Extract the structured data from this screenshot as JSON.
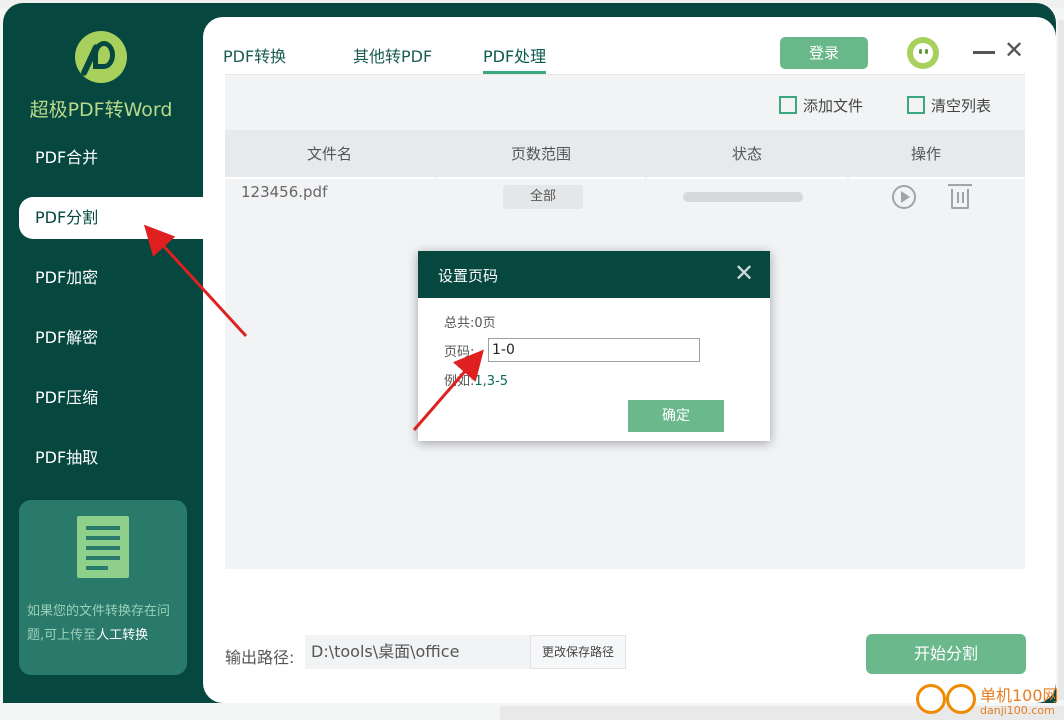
{
  "app": {
    "title": "超极PDF转Word"
  },
  "sidebar": {
    "items": [
      {
        "label": "PDF合并"
      },
      {
        "label": "PDF分割"
      },
      {
        "label": "PDF加密"
      },
      {
        "label": "PDF解密"
      },
      {
        "label": "PDF压缩"
      },
      {
        "label": "PDF抽取"
      }
    ],
    "active_index": 1,
    "promo_text_prefix": "如果您的文件转换存在问题,可上传至",
    "promo_text_link": "人工转换"
  },
  "header": {
    "tabs": [
      {
        "label": "PDF转换"
      },
      {
        "label": "其他转PDF"
      },
      {
        "label": "PDF处理"
      }
    ],
    "active_tab": 2,
    "login_label": "登录"
  },
  "toolbar": {
    "add_file_label": "添加文件",
    "clear_list_label": "清空列表"
  },
  "table": {
    "columns": [
      "文件名",
      "页数范围",
      "状态",
      "操作"
    ],
    "rows": [
      {
        "filename": "123456.pdf",
        "range": "全部"
      }
    ]
  },
  "footer": {
    "output_label": "输出路径:",
    "output_path": "D:\\tools\\桌面\\office",
    "change_path_label": "更改保存路径",
    "start_label": "开始分割"
  },
  "dialog": {
    "title": "设置页码",
    "total_label": "总共:",
    "total_value": "0页",
    "page_label": "页码:",
    "page_value": "1-0",
    "example_label": "例如:",
    "example_value": "1,3-5",
    "ok_label": "确定"
  },
  "watermark": {
    "line1": "单机100网",
    "line2": "danji100.com"
  },
  "colors": {
    "sidebar_bg": "#064740",
    "accent": "#6bb88c",
    "logo_green": "#a7d05c",
    "annotation_red": "#e02020"
  }
}
